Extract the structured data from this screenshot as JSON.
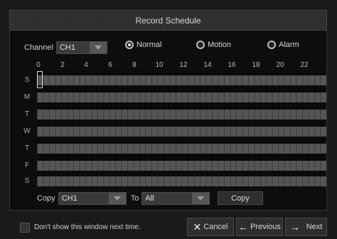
{
  "dialog": {
    "title": "Record Schedule"
  },
  "channel": {
    "label": "Channel",
    "value": "CH1"
  },
  "modes": [
    {
      "label": "Normal",
      "selected": true
    },
    {
      "label": "Motion",
      "selected": false
    },
    {
      "label": "Alarm",
      "selected": false
    }
  ],
  "hours": [
    "0",
    "2",
    "4",
    "6",
    "8",
    "10",
    "12",
    "14",
    "16",
    "18",
    "20",
    "22"
  ],
  "days": [
    "S",
    "M",
    "T",
    "W",
    "T",
    "F",
    "S"
  ],
  "schedule_fill_fraction": [
    1,
    1,
    1,
    1,
    1,
    1,
    1
  ],
  "copy": {
    "label": "Copy",
    "from_value": "CH1",
    "to_label": "To",
    "to_value": "All",
    "button_label": "Copy"
  },
  "footer": {
    "dont_show_label": "Don't show this window next time.",
    "cancel_label": "Cancel",
    "previous_label": "Previous",
    "next_label": "Next"
  },
  "colors": {
    "background": "#1a1a1a",
    "grid_fill": "#555555",
    "accent_text": "#d8d8d8"
  }
}
